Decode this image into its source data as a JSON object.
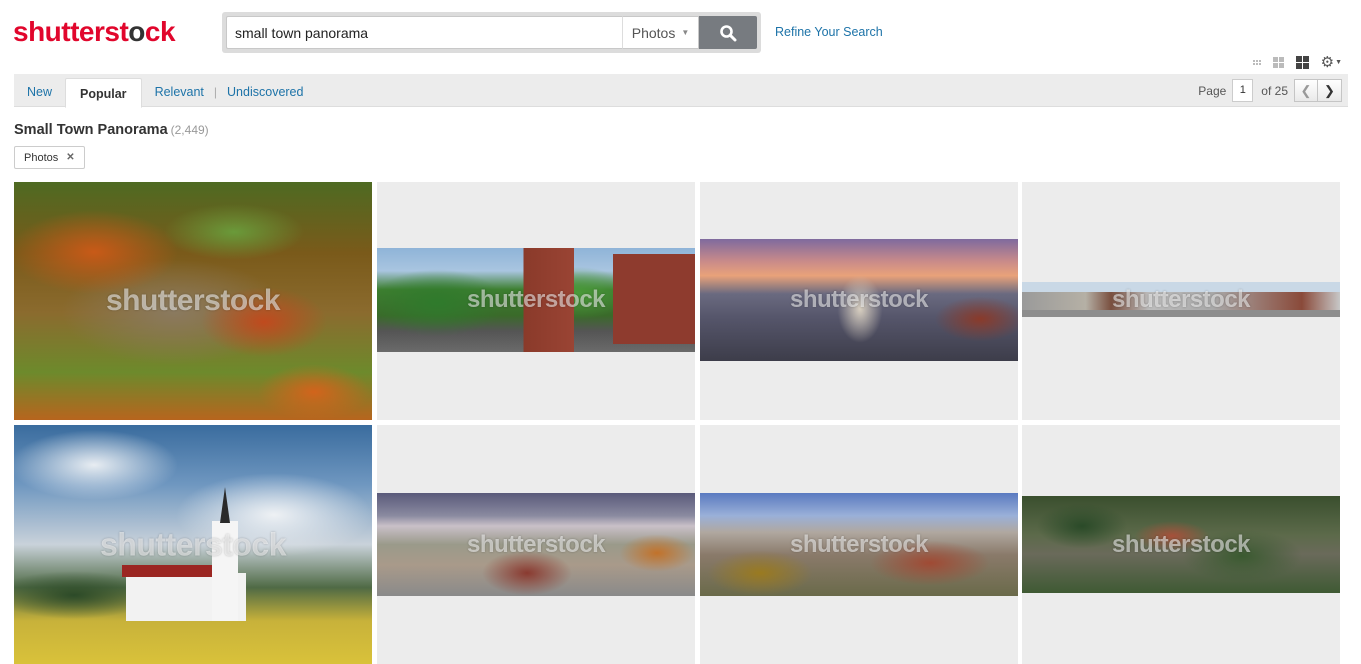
{
  "brand": {
    "logo_text": "shutterstock",
    "brand_color": "#e1062c"
  },
  "search": {
    "query": "small town panorama",
    "type_value": "Photos",
    "refine_label": "Refine Your Search"
  },
  "sort_tabs": [
    {
      "label": "New",
      "active": false
    },
    {
      "label": "Popular",
      "active": true
    },
    {
      "label": "Relevant",
      "active": false
    },
    {
      "label": "Undiscovered",
      "active": false
    }
  ],
  "tab_separator": "|",
  "pagination": {
    "page_label": "Page",
    "current_page": "1",
    "of_label": "of 25"
  },
  "results": {
    "title": "Small Town Panorama",
    "count": "(2,449)"
  },
  "filters": [
    {
      "label": "Photos"
    }
  ],
  "view_icons": [
    "small-grid-icon",
    "medium-grid-icon",
    "large-grid-icon",
    "gear-icon"
  ],
  "watermark": "shutterstock",
  "link_color": "#1d73a8"
}
